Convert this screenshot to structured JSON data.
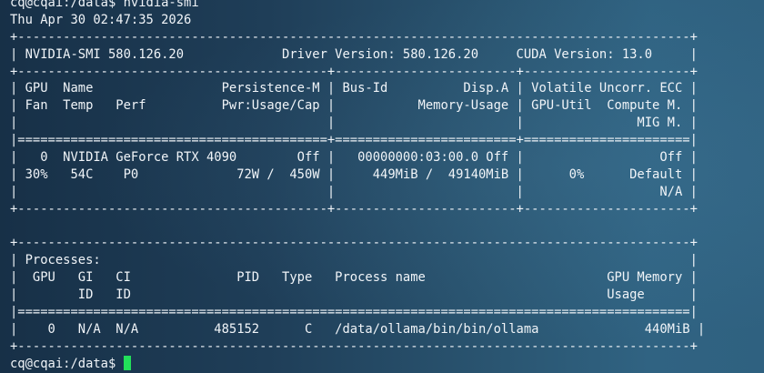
{
  "terminal": {
    "lines": [
      "cq@cqai:/data$ nvidia-smi",
      "Thu Apr 30 02:47:35 2026",
      "+-----------------------------------------------------------------------------------------+",
      "| NVIDIA-SMI 580.126.20             Driver Version: 580.126.20     CUDA Version: 13.0     |",
      "+-----------------------------------------+------------------------+----------------------+",
      "| GPU  Name                 Persistence-M | Bus-Id          Disp.A | Volatile Uncorr. ECC |",
      "| Fan  Temp   Perf          Pwr:Usage/Cap |           Memory-Usage | GPU-Util  Compute M. |",
      "|                                         |                        |               MIG M. |",
      "|=========================================+========================+======================|",
      "|   0  NVIDIA GeForce RTX 4090        Off |   00000000:03:00.0 Off |                  Off |",
      "| 30%   54C    P0             72W /  450W |     449MiB /  49140MiB |      0%      Default |",
      "|                                         |                        |                  N/A |",
      "+-----------------------------------------+------------------------+----------------------+",
      "",
      "+-----------------------------------------------------------------------------------------+",
      "| Processes:                                                                              |",
      "|  GPU   GI   CI              PID   Type   Process name                        GPU Memory |",
      "|        ID   ID                                                               Usage      |",
      "|=========================================================================================|",
      "|    0   N/A  N/A          485152      C   /data/ollama/bin/bin/ollama              440MiB |",
      "+-----------------------------------------------------------------------------------------+"
    ],
    "prompt": "cq@cqai:/data$ "
  },
  "colors": {
    "text": "#f0f4f8",
    "cursor": "#22e05a",
    "background_left": "#173047",
    "background_right": "#306382"
  }
}
